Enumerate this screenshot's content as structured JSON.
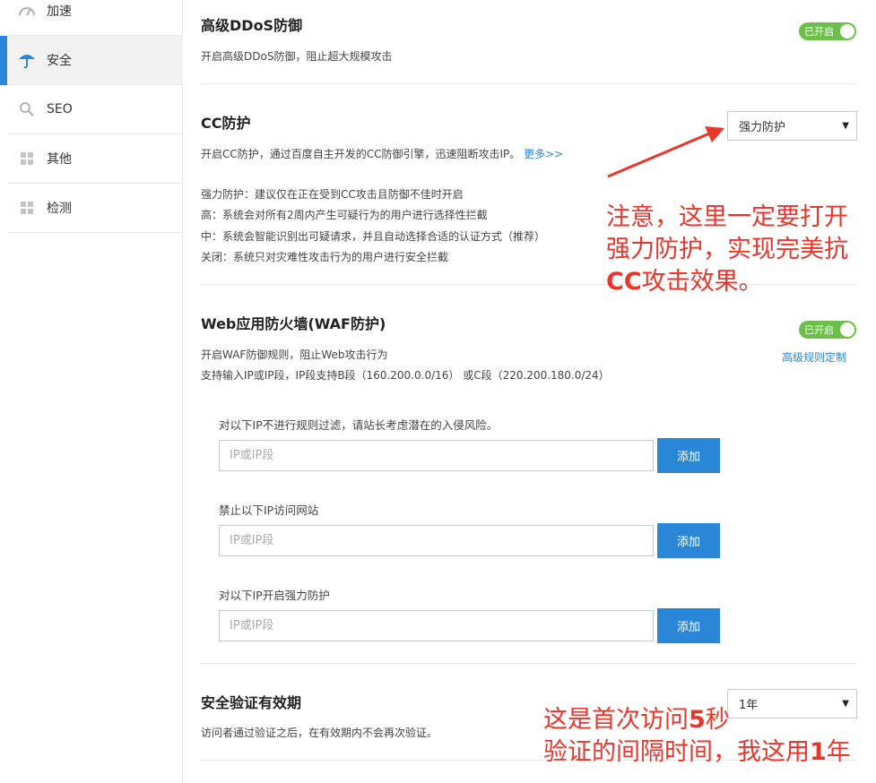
{
  "sidebar": {
    "items": [
      {
        "label": "加速",
        "icon": "speedometer-icon"
      },
      {
        "label": "安全",
        "icon": "umbrella-icon"
      },
      {
        "label": "SEO",
        "icon": "search-icon"
      },
      {
        "label": "其他",
        "icon": "grid-icon"
      },
      {
        "label": "检测",
        "icon": "grid-icon"
      }
    ]
  },
  "ddos": {
    "title": "高级DDoS防御",
    "desc": "开启高级DDoS防御，阻止超大规模攻击",
    "toggle_label": "已开启"
  },
  "cc": {
    "title": "CC防护",
    "desc": "开启CC防护，通过百度自主开发的CC防御引擎，迅速阻断攻击IP。",
    "more_link": "更多>>",
    "select_value": "强力防护",
    "levels": [
      "强力防护：建议仅在正在受到CC攻击且防御不佳时开启",
      "高：系统会对所有2周内产生可疑行为的用户进行选择性拦截",
      "中：系统会智能识别出可疑请求，并且自动选择合适的认证方式（推荐）",
      "关闭：系统只对灾难性攻击行为的用户进行安全拦截"
    ]
  },
  "waf": {
    "title": "Web应用防火墙(WAF防护)",
    "toggle_label": "已开启",
    "desc1": "开启WAF防御规则，阻止Web攻击行为",
    "desc2": "支持输入IP或IP段，IP段支持B段（160.200.0.0/16） 或C段（220.200.180.0/24）",
    "advanced_link": "高级规则定制",
    "rules": [
      {
        "label": "对以下IP不进行规则过滤，请站长考虑潜在的入侵风险。",
        "placeholder": "IP或IP段",
        "button": "添加"
      },
      {
        "label": "禁止以下IP访问网站",
        "placeholder": "IP或IP段",
        "button": "添加"
      },
      {
        "label": "对以下IP开启强力防护",
        "placeholder": "IP或IP段",
        "button": "添加"
      }
    ]
  },
  "verify": {
    "title": "安全验证有效期",
    "desc": "访问者通过验证之后，在有效期内不会再次验证。",
    "select_value": "1年"
  },
  "annotations": {
    "note1": {
      "line1": "注意，这里一定要打开",
      "line2": "强力防护，实现完美抗",
      "line3_bold": "CC",
      "line3": "攻击效果。"
    },
    "note2": {
      "line1_a": "这是首次访问",
      "line1_bold": "5",
      "line1_b": "秒",
      "line2_a": "验证的间隔时间，我这用",
      "line2_bold": "1",
      "line2_b": "年"
    }
  },
  "colors": {
    "accent": "#2a87d8",
    "toggle_on": "#6cc04a",
    "annotation": "#e8362b"
  }
}
